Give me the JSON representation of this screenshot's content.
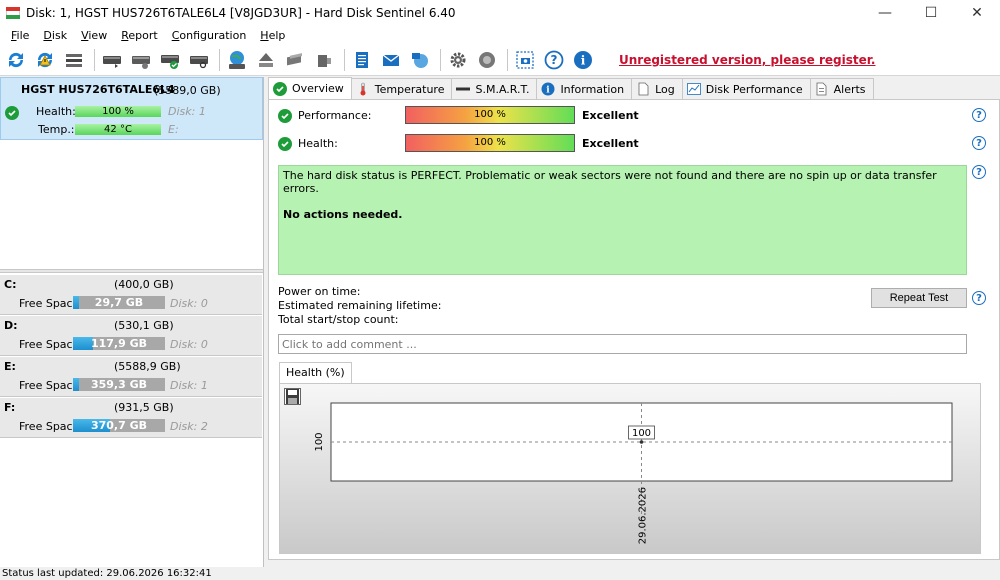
{
  "window": {
    "title": "Disk: 1, HGST HUS726T6TALE6L4 [V8JGD3UR]  -  Hard Disk Sentinel 6.40",
    "minimize": "—",
    "maximize": "☐",
    "close": "✕"
  },
  "menu": [
    "File",
    "Disk",
    "View",
    "Report",
    "Configuration",
    "Help"
  ],
  "toolbar": {
    "unregistered_text": "Unregistered version, please register."
  },
  "disk": {
    "name": "HGST HUS726T6TALE6L4",
    "size": "(5589,0 GB)",
    "health_label": "Health:",
    "health_value": "100 %",
    "health_fraction": 1.0,
    "disk_ref": "Disk: 1",
    "temp_label": "Temp.:",
    "temp_value": "42 °C",
    "temp_drive": "E:"
  },
  "volumes": [
    {
      "letter": "C:",
      "size": "(400,0 GB)",
      "free_label": "Free Space",
      "free": "29,7 GB",
      "used_fraction": 0.07,
      "disk": "Disk: 0",
      "bar_color": "#1d8fce"
    },
    {
      "letter": "D:",
      "size": "(530,1 GB)",
      "free_label": "Free Space",
      "free": "117,9 GB",
      "used_fraction": 0.22,
      "disk": "Disk: 0",
      "bar_color": "#1d8fce"
    },
    {
      "letter": "E:",
      "size": "(5588,9 GB)",
      "free_label": "Free Space",
      "free": "359,3 GB",
      "used_fraction": 0.06,
      "disk": "Disk: 1",
      "bar_color": "#1d8fce"
    },
    {
      "letter": "F:",
      "size": "(931,5 GB)",
      "free_label": "Free Space",
      "free": "370,7 GB",
      "used_fraction": 0.4,
      "disk": "Disk: 2",
      "bar_color": "#1d8fce"
    }
  ],
  "tabs": [
    "Overview",
    "Temperature",
    "S.M.A.R.T.",
    "Information",
    "Log",
    "Disk Performance",
    "Alerts"
  ],
  "overview": {
    "performance_label": "Performance:",
    "performance_value": "100 %",
    "performance_rating": "Excellent",
    "health_label": "Health:",
    "health_value": "100 %",
    "health_rating": "Excellent",
    "status_message": "The hard disk status is PERFECT. Problematic or weak sectors were not found and there are no spin up or data transfer errors.",
    "action_message": "No actions needed.",
    "power_on_label": "Power on time:",
    "lifetime_label": "Estimated remaining lifetime:",
    "startstop_label": "Total start/stop count:",
    "repeat_button": "Repeat Test",
    "comment_placeholder": "Click to add comment ..."
  },
  "chart_tab_label": "Health (%)",
  "chart_data": {
    "type": "line",
    "x": [
      "29.06.2026"
    ],
    "values": [
      100
    ],
    "data_labels": [
      "100"
    ],
    "y_tick_labels": [
      "100"
    ],
    "x_tick_labels": [
      "29.06.2026"
    ],
    "grid": true
  },
  "statusbar": {
    "text": "Status last updated: 29.06.2026 16:32:41"
  },
  "colors": {
    "accent_green": "#1e9c3a",
    "status_box": "#b6f2b2",
    "unregistered": "#c8102e",
    "help_blue": "#1a6ec0"
  }
}
